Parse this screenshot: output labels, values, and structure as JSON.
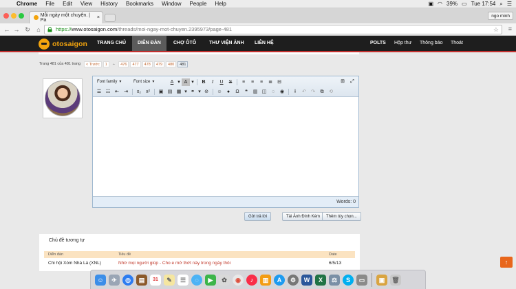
{
  "os_menubar": {
    "app": "Chrome",
    "items": [
      "File",
      "Edit",
      "View",
      "History",
      "Bookmarks",
      "Window",
      "People",
      "Help"
    ],
    "battery": "39%",
    "clock": "Tue 17:54"
  },
  "browser": {
    "tab_title": "Mỗi ngày một chuyện. | Pa",
    "profile": "ngo minh",
    "url_scheme": "https://",
    "url_host": "www.otosaigon.com",
    "url_path": "/threads/moi-ngay-mot-chuyen.2395973/page-481"
  },
  "site": {
    "logo": "otosaigon",
    "nav": [
      "TRANG CHỦ",
      "DIỄN ĐÀN",
      "CHỢ ÔTÔ",
      "THƯ VIỆN ẢNH",
      "LIÊN HỆ"
    ],
    "active_nav": "DIỄN ĐÀN",
    "nav_right": [
      "POLTS",
      "Hộp thư",
      "Thông báo",
      "Thoát"
    ],
    "accent_color": "#c3312f",
    "logo_color": "#f3a40e"
  },
  "pagination": {
    "label": "Trang 481 của 481 trang",
    "prev": "< Trước",
    "first": "1",
    "ellipsis": "←",
    "pages": [
      "476",
      "477",
      "478",
      "479",
      "480"
    ],
    "current": "481"
  },
  "editor": {
    "font_family": "Font family",
    "font_size": "Font size",
    "word_count": "Words: 0"
  },
  "actions": {
    "submit": "Gửi trả lời",
    "attach": "Tải Ảnh Đính Kèm",
    "more": "Thêm tùy chọn..."
  },
  "similar": {
    "title": "Chủ đề tương tự",
    "headers": [
      "Diễn đàn",
      "Tiêu đề",
      "Date"
    ],
    "rows": [
      {
        "forum": "Chi hội Xóm Nhà Lá (XNL)",
        "title": "Nhờ mọi người giúp - Cho e mở thớt này trong ngày thôi",
        "date": "6/5/13"
      }
    ]
  }
}
